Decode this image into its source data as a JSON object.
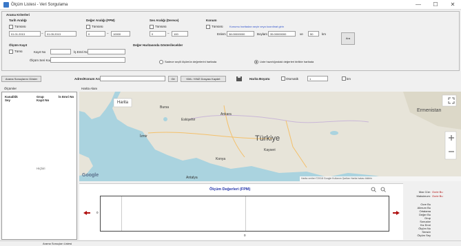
{
  "window": {
    "title": "Ölçüm Listesi - Veri Sorgulama",
    "min_glyph": "—",
    "max_glyph": "☐",
    "close_glyph": "✕"
  },
  "criteria": {
    "group_title": "Arama Kriterleri",
    "date_range": {
      "title": "Tarih Aralığı",
      "checkbox_label": "Tümünü",
      "from": "01.01.2013",
      "to": "01.05.2013"
    },
    "value_range": {
      "title": "Değer Aralığı (FPM)",
      "checkbox_label": "Tümünü",
      "min": "0",
      "max": "10000"
    },
    "depth_range": {
      "title": "Ses Aralığı (Derece)",
      "checkbox_label": "Tümünü",
      "min": "0",
      "max": "100"
    },
    "location": {
      "title": "Konum",
      "checkbox_label": "Tümünü",
      "hint": "Konumu haritadan seçin veya koordinat girin",
      "lat_label": "Enlem",
      "lat_value": "38.00000000",
      "lon_label": "Boylam",
      "lon_value": "35.00000000",
      "radius_prefix": "ve",
      "radius_value": "50",
      "radius_unit": "km",
      "apply_label": "Ara"
    },
    "measurement": {
      "title": "Ölçüm Kayıt",
      "checkbox_label": "Tümü",
      "record_no_label": "Kayıt No",
      "range_label": "İş Emri No",
      "device_label": "Ölçüm Seri Kodu"
    },
    "display": {
      "title": "Değer Haritasında Gösterilecekler",
      "option1": "Sadece seçili ölçümün değerlerini haritada",
      "option2": "Liste hazırlığındaki değerleri birlikte haritada"
    }
  },
  "toolbar": {
    "list_button": "Arama Sonuçlarını Göster",
    "address_label": "Adres/Konum Ara",
    "address_value": "",
    "search_button": "Git",
    "export_button": "KML / KMZ Dosyası Kaydet",
    "map_type_label": "Harita Boyutu",
    "map_type_checkbox": "Otomatik",
    "map_type_value": "1",
    "zoom_label": "km"
  },
  "list": {
    "title": "Ölçümler",
    "columns": [
      "Kanalitik Sey",
      "Grup Kayıt No",
      "İs Emri No"
    ],
    "empty_text": "Hiçbiri"
  },
  "map": {
    "title": "Harita Alanı",
    "map_type_button": "Harita",
    "country_label": "Türkiye",
    "east_label": "Ermenistan",
    "cities": [
      "Bursa",
      "Eskişehir",
      "Ankara",
      "Kayseri",
      "Konya",
      "Antalya",
      "İzmir"
    ],
    "google_label": "Google",
    "attribution": "Harita verileri ©2018 Google    Kullanım Şartları    Harita hatası bildirin"
  },
  "chart": {
    "title": "Ölçüm Değerleri (FPM)",
    "y_tick": "0",
    "x_tick": "0"
  },
  "side_info": {
    "max_label": "Max Cüe:",
    "max_value": "Ocrie Bu",
    "min_label": "Maksimum:",
    "min_value": "Ocrie Bu",
    "detail_lines": [
      "Ocre Bu",
      "Alimum Bu",
      "Ortalama",
      "Değer Bu",
      "Grup",
      "Sonuclar",
      "Hız Emri",
      "Ölçüm No",
      "Sensör",
      "Ölçüm Sey"
    ]
  },
  "status": {
    "text": "Arama Sonuçları Listesi"
  }
}
